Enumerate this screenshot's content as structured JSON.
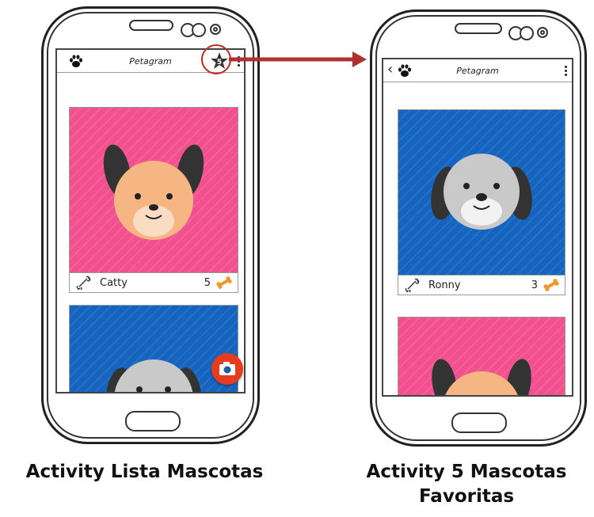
{
  "left_screen": {
    "app_title": "Petagram",
    "favorites_badge_count": "5",
    "card1": {
      "name": "Catty",
      "likes": "5"
    }
  },
  "right_screen": {
    "app_title": "Petagram",
    "back_glyph": "‹",
    "card1": {
      "name": "Ronny",
      "likes": "3"
    }
  },
  "captions": {
    "left": "Activity Lista Mascotas",
    "right_line1": "Activity 5 Mascotas",
    "right_line2": "Favoritas"
  },
  "colors": {
    "pink_card": "#f2508e",
    "blue_card": "#1565c0",
    "fab": "#e53b1f",
    "arrow": "#b03030",
    "bone": "#f0962a"
  },
  "icons": [
    "paw-icon",
    "star-icon",
    "kebab-menu-icon",
    "back-arrow-icon",
    "bone-outline-icon",
    "bone-filled-icon",
    "camera-icon"
  ]
}
